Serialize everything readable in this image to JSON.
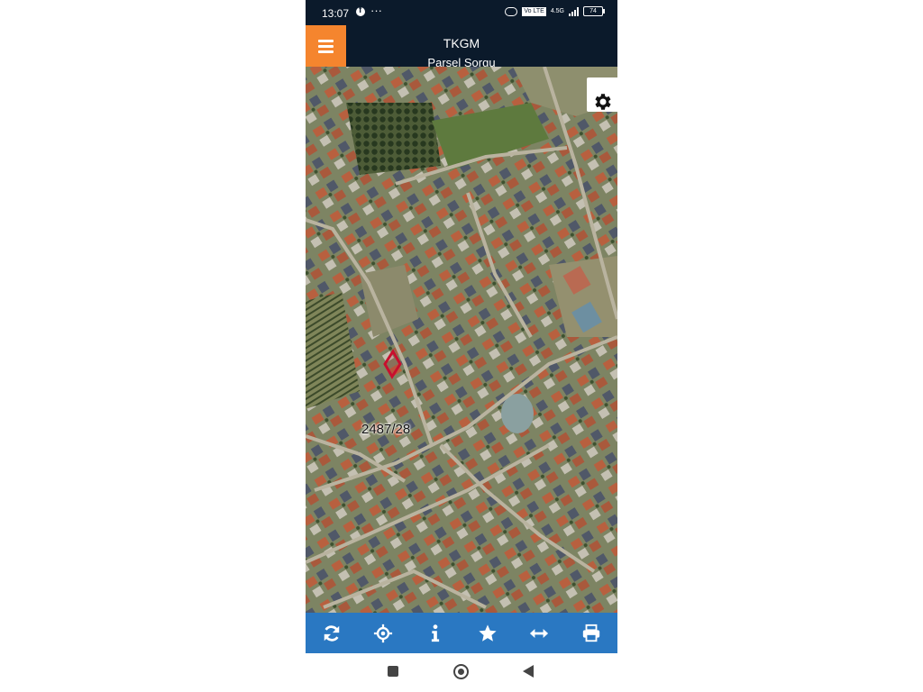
{
  "status_bar": {
    "time": "13:07",
    "network_volte": "Vo LTE",
    "network_type": "4.5G",
    "battery": "74"
  },
  "header": {
    "title": "TKGM",
    "subtitle": "Parsel Sorgu"
  },
  "map": {
    "parcel_label": "2487/28"
  },
  "toolbar": {
    "icons": [
      "refresh-icon",
      "locate-icon",
      "info-icon",
      "star-icon",
      "measure-icon",
      "print-icon"
    ]
  },
  "nav_bar": {
    "icons": [
      "recents-icon",
      "home-icon",
      "back-icon"
    ]
  },
  "colors": {
    "header_bg": "#0b1a2b",
    "menu_accent": "#f5852e",
    "toolbar_bg": "#2a78c2",
    "parcel_outline": "#c8102e"
  }
}
